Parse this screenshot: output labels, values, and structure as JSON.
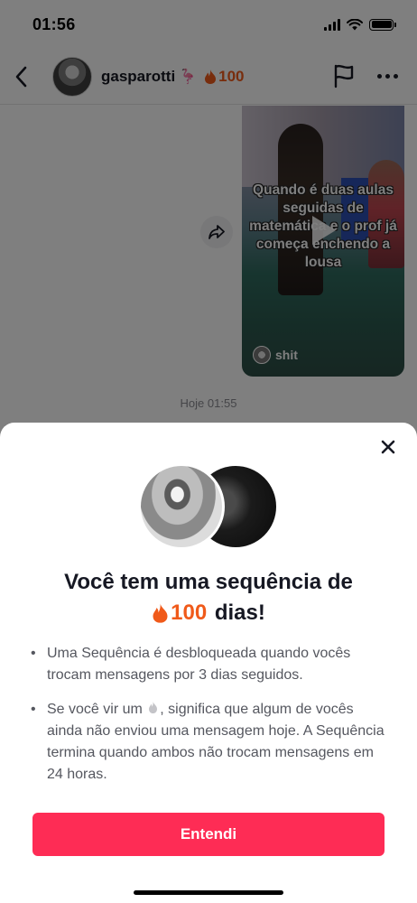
{
  "status_bar": {
    "time": "01:56"
  },
  "header": {
    "username": "gasparotti",
    "flamingo": "🦩",
    "streak_count": "100"
  },
  "chat": {
    "video_caption": "Quando é duas aulas seguidas de matemática e o prof já começa enchendo a lousa",
    "sound_label": "shit",
    "timestamp": "Hoje 01:55"
  },
  "sheet": {
    "title_line1": "Você tem uma sequência de",
    "title_streak": "100",
    "title_suffix": " dias!",
    "bullet1": "Uma Sequência é desbloqueada quando vocês trocam mensagens por 3 dias seguidos.",
    "bullet2_prefix": "Se você vir um ",
    "bullet2_suffix": ", significa que algum de vocês ainda não enviou uma mensagem hoje. A Sequência termina quando ambos não trocam mensagens em 24 horas.",
    "button_label": "Entendi"
  },
  "colors": {
    "accent": "#fe2c55",
    "streak": "#f05a1a"
  },
  "icons": [
    "back-arrow-icon",
    "flame-icon",
    "flag-icon",
    "more-icon",
    "share-icon",
    "play-icon",
    "close-icon",
    "grey-drop-icon"
  ]
}
